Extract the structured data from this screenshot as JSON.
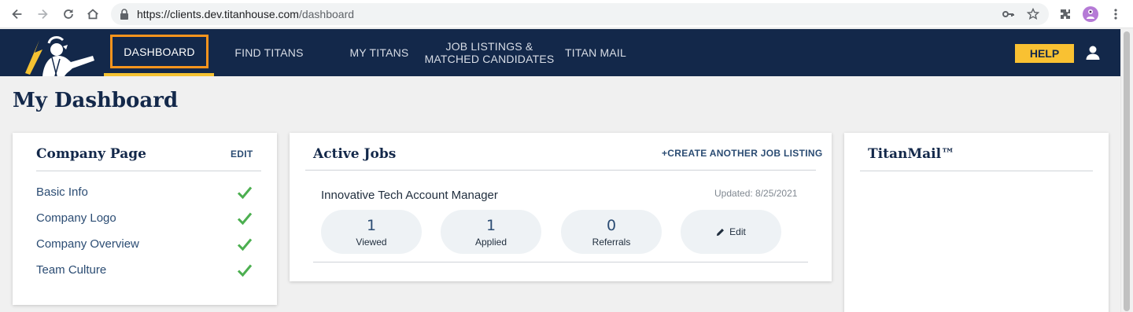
{
  "browser": {
    "url_host": "https://clients.dev.titanhouse.com",
    "url_path": "/dashboard",
    "icons": [
      "back-icon",
      "forward-icon",
      "reload-icon",
      "home-icon",
      "lock-icon",
      "key-icon",
      "star-icon",
      "extensions-icon",
      "profile-avatar",
      "menu-dots-icon"
    ]
  },
  "nav": {
    "items": [
      {
        "label": "DASHBOARD",
        "active": true
      },
      {
        "label": "FIND TITANS"
      },
      {
        "label": "MY TITANS"
      },
      {
        "label_line1": "JOB LISTINGS &",
        "label_line2": "MATCHED CANDIDATES"
      },
      {
        "label": "TITAN MAIL"
      }
    ],
    "help_label": "HELP",
    "colors": {
      "bg": "#13284a",
      "accent": "#f9c132",
      "highlight": "#f7941d"
    }
  },
  "page": {
    "title": "My Dashboard"
  },
  "company_page": {
    "title": "Company Page",
    "edit_label": "EDIT",
    "items": [
      {
        "label": "Basic Info",
        "complete": true
      },
      {
        "label": "Company Logo",
        "complete": true
      },
      {
        "label": "Company Overview",
        "complete": true
      },
      {
        "label": "Team Culture",
        "complete": true
      }
    ]
  },
  "active_jobs": {
    "title": "Active Jobs",
    "create_label": "+CREATE ANOTHER JOB LISTING",
    "jobs": [
      {
        "title": "Innovative Tech Account Manager",
        "updated": "Updated: 8/25/2021",
        "stats": [
          {
            "value": "1",
            "label": "Viewed"
          },
          {
            "value": "1",
            "label": "Applied"
          },
          {
            "value": "0",
            "label": "Referrals"
          }
        ],
        "edit_label": "Edit"
      }
    ]
  },
  "titanmail": {
    "title": "TitanMail™"
  }
}
